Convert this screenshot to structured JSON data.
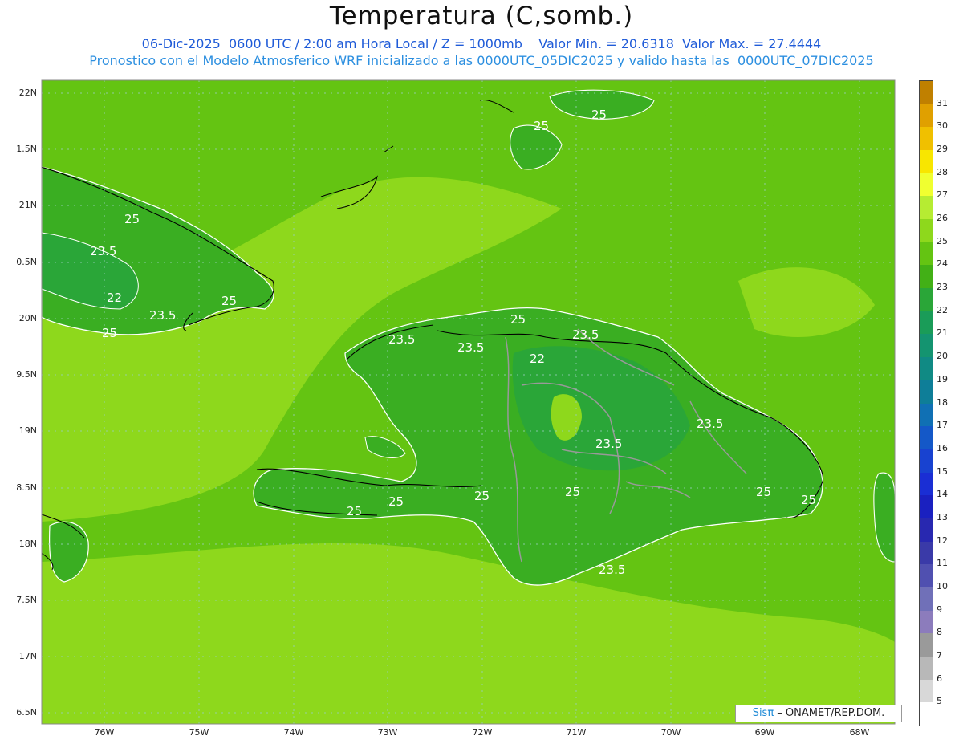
{
  "title": "Temperatura (C,somb.)",
  "subtitle1": "06-Dic-2025  0600 UTC / 2:00 am Hora Local / Z = 1000mb    Valor Min. = 20.6318  Valor Max. = 27.4444",
  "subtitle2": "Pronostico con el Modelo Atmosferico WRF inicializado a las 0000UTC_05DIC2025 y valido hasta las  0000UTC_07DIC2025",
  "lat_labels": [
    "22N",
    "1.5N",
    "21N",
    "0.5N",
    "20N",
    "9.5N",
    "19N",
    "8.5N",
    "18N",
    "7.5N",
    "17N",
    "6.5N"
  ],
  "lon_labels": [
    "76W",
    "75W",
    "74W",
    "73W",
    "72W",
    "71W",
    "70W",
    "69W",
    "68W"
  ],
  "contour_labels": [
    "25",
    "25",
    "25",
    "23.5",
    "22",
    "23.5",
    "25",
    "25",
    "23.5",
    "22",
    "23.5",
    "25",
    "23.5",
    "23.5",
    "23.5",
    "25",
    "25",
    "25",
    "25",
    "23.5",
    "25",
    "25"
  ],
  "colorbar": {
    "labels": [
      "31",
      "30",
      "29",
      "28",
      "27",
      "26",
      "25",
      "24",
      "23",
      "22",
      "21",
      "20",
      "19",
      "18",
      "17",
      "16",
      "15",
      "14",
      "13",
      "12",
      "11",
      "10",
      "9",
      "8",
      "7",
      "6",
      "5"
    ],
    "colors": [
      "#c08000",
      "#e0a000",
      "#f0c000",
      "#f8e600",
      "#f0ff30",
      "#b6ec32",
      "#8ed81c",
      "#64c412",
      "#42b016",
      "#2aa638",
      "#1a9c58",
      "#149470",
      "#108a84",
      "#0e7e98",
      "#1070b4",
      "#1458c8",
      "#1842d0",
      "#1a2ed4",
      "#1a20c0",
      "#2828b0",
      "#3a3aa8",
      "#5050b0",
      "#7070b8",
      "#8c7cbc",
      "#9a9a9a",
      "#b8b8b8",
      "#d8d8d8",
      "#ffffff"
    ]
  },
  "credit": {
    "brand": "Sisπ",
    "text": " – ONAMET/REP.DOM."
  }
}
